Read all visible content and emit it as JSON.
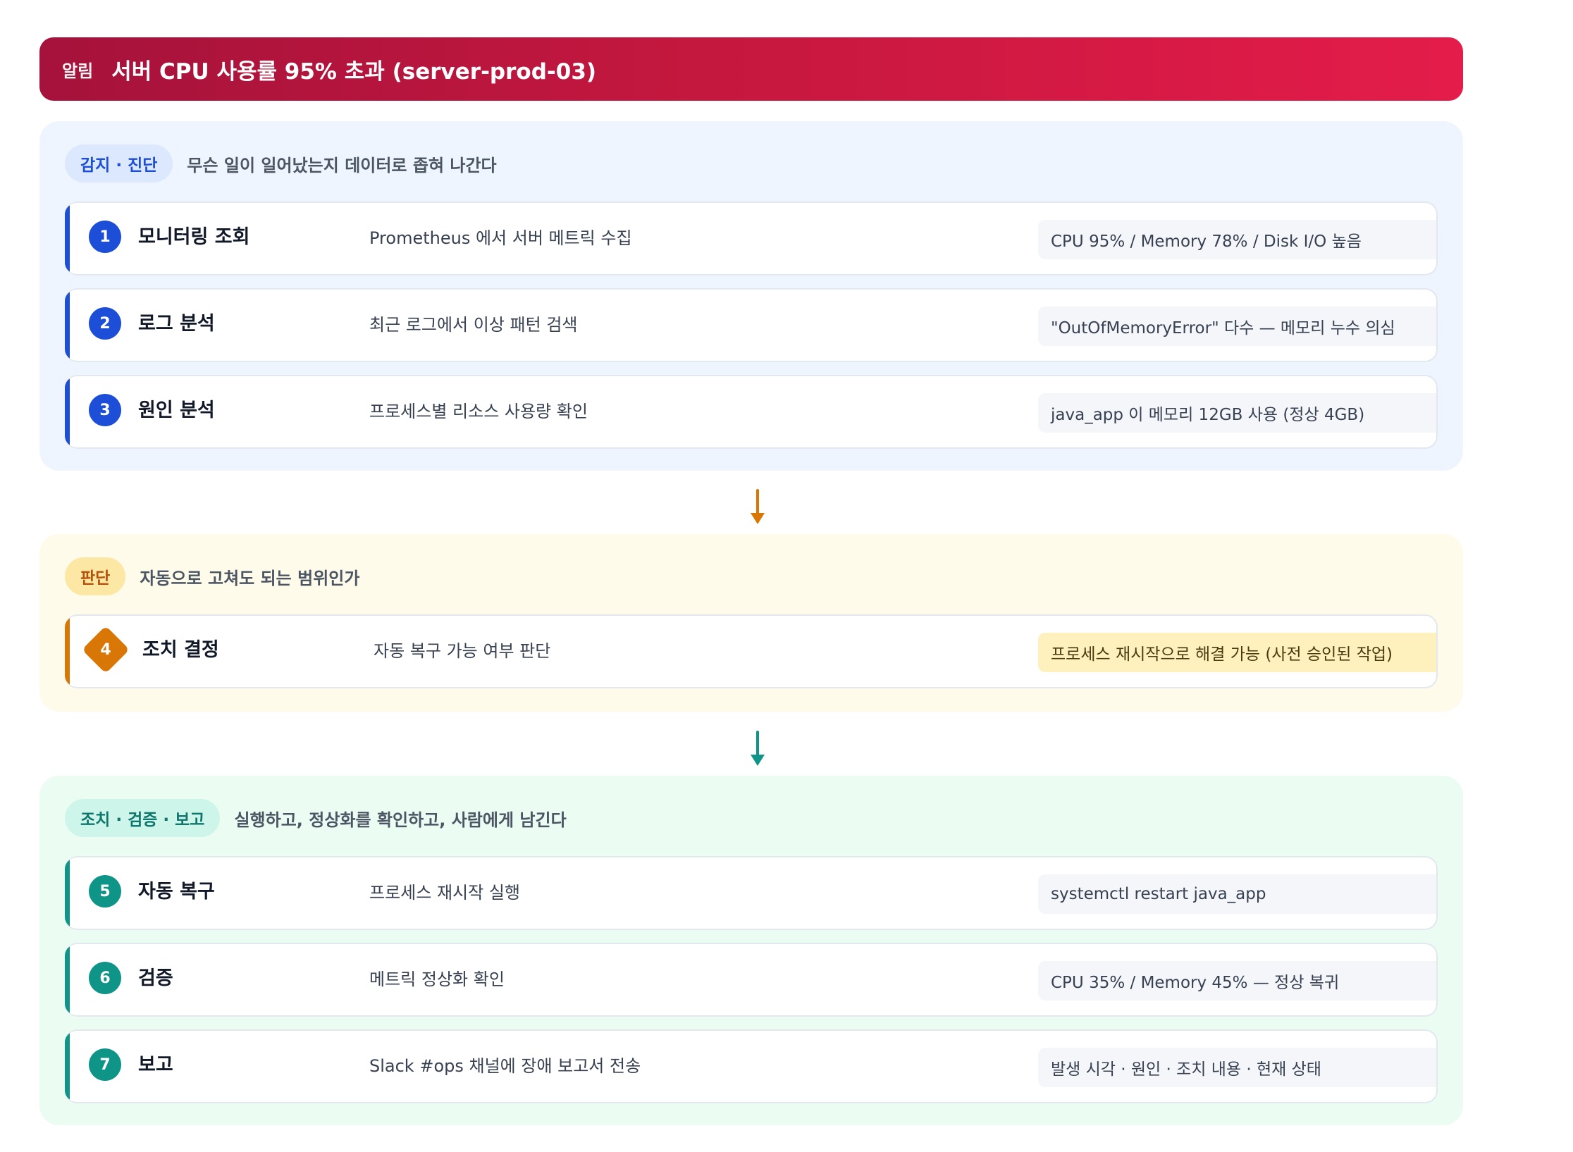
{
  "alert": {
    "tag": "알림",
    "title": "서버 CPU 사용률 95% 초과 (server-prod-03)"
  },
  "sections": [
    {
      "label": "감지 · 진단",
      "description": "무슨 일이 일어났는지 데이터로 좁혀 나간다",
      "color": "#1d4ed8",
      "steps": [
        {
          "number": "1",
          "title": "모니터링 조회",
          "description": "Prometheus 에서 서버 메트릭 수집",
          "result": "CPU 95% / Memory 78% / Disk I/O 높음"
        },
        {
          "number": "2",
          "title": "로그 분석",
          "description": "최근 로그에서 이상 패턴 검색",
          "result": "\"OutOfMemoryError\" 다수 — 메모리 누수 의심"
        },
        {
          "number": "3",
          "title": "원인 분석",
          "description": "프로세스별 리소스 사용량 확인",
          "result": "java_app 이 메모리 12GB 사용 (정상 4GB)"
        }
      ]
    },
    {
      "label": "판단",
      "description": "자동으로 고쳐도 되는 범위인가",
      "color": "#d97706",
      "steps": [
        {
          "number": "4",
          "title": "조치 결정",
          "description": "자동 복구 가능 여부 판단",
          "result": "프로세스 재시작으로 해결 가능 (사전 승인된 작업)"
        }
      ]
    },
    {
      "label": "조치 · 검증 · 보고",
      "description": "실행하고, 정상화를 확인하고, 사람에게 남긴다",
      "color": "#0f9488",
      "steps": [
        {
          "number": "5",
          "title": "자동 복구",
          "description": "프로세스 재시작 실행",
          "result": "systemctl restart java_app"
        },
        {
          "number": "6",
          "title": "검증",
          "description": "메트릭 정상화 확인",
          "result": "CPU 35% / Memory 45% — 정상 복귀"
        },
        {
          "number": "7",
          "title": "보고",
          "description": "Slack #ops 채널에 장애 보고서 전송",
          "result": "발생 시각 · 원인 · 조치 내용 · 현재 상태"
        }
      ]
    }
  ]
}
